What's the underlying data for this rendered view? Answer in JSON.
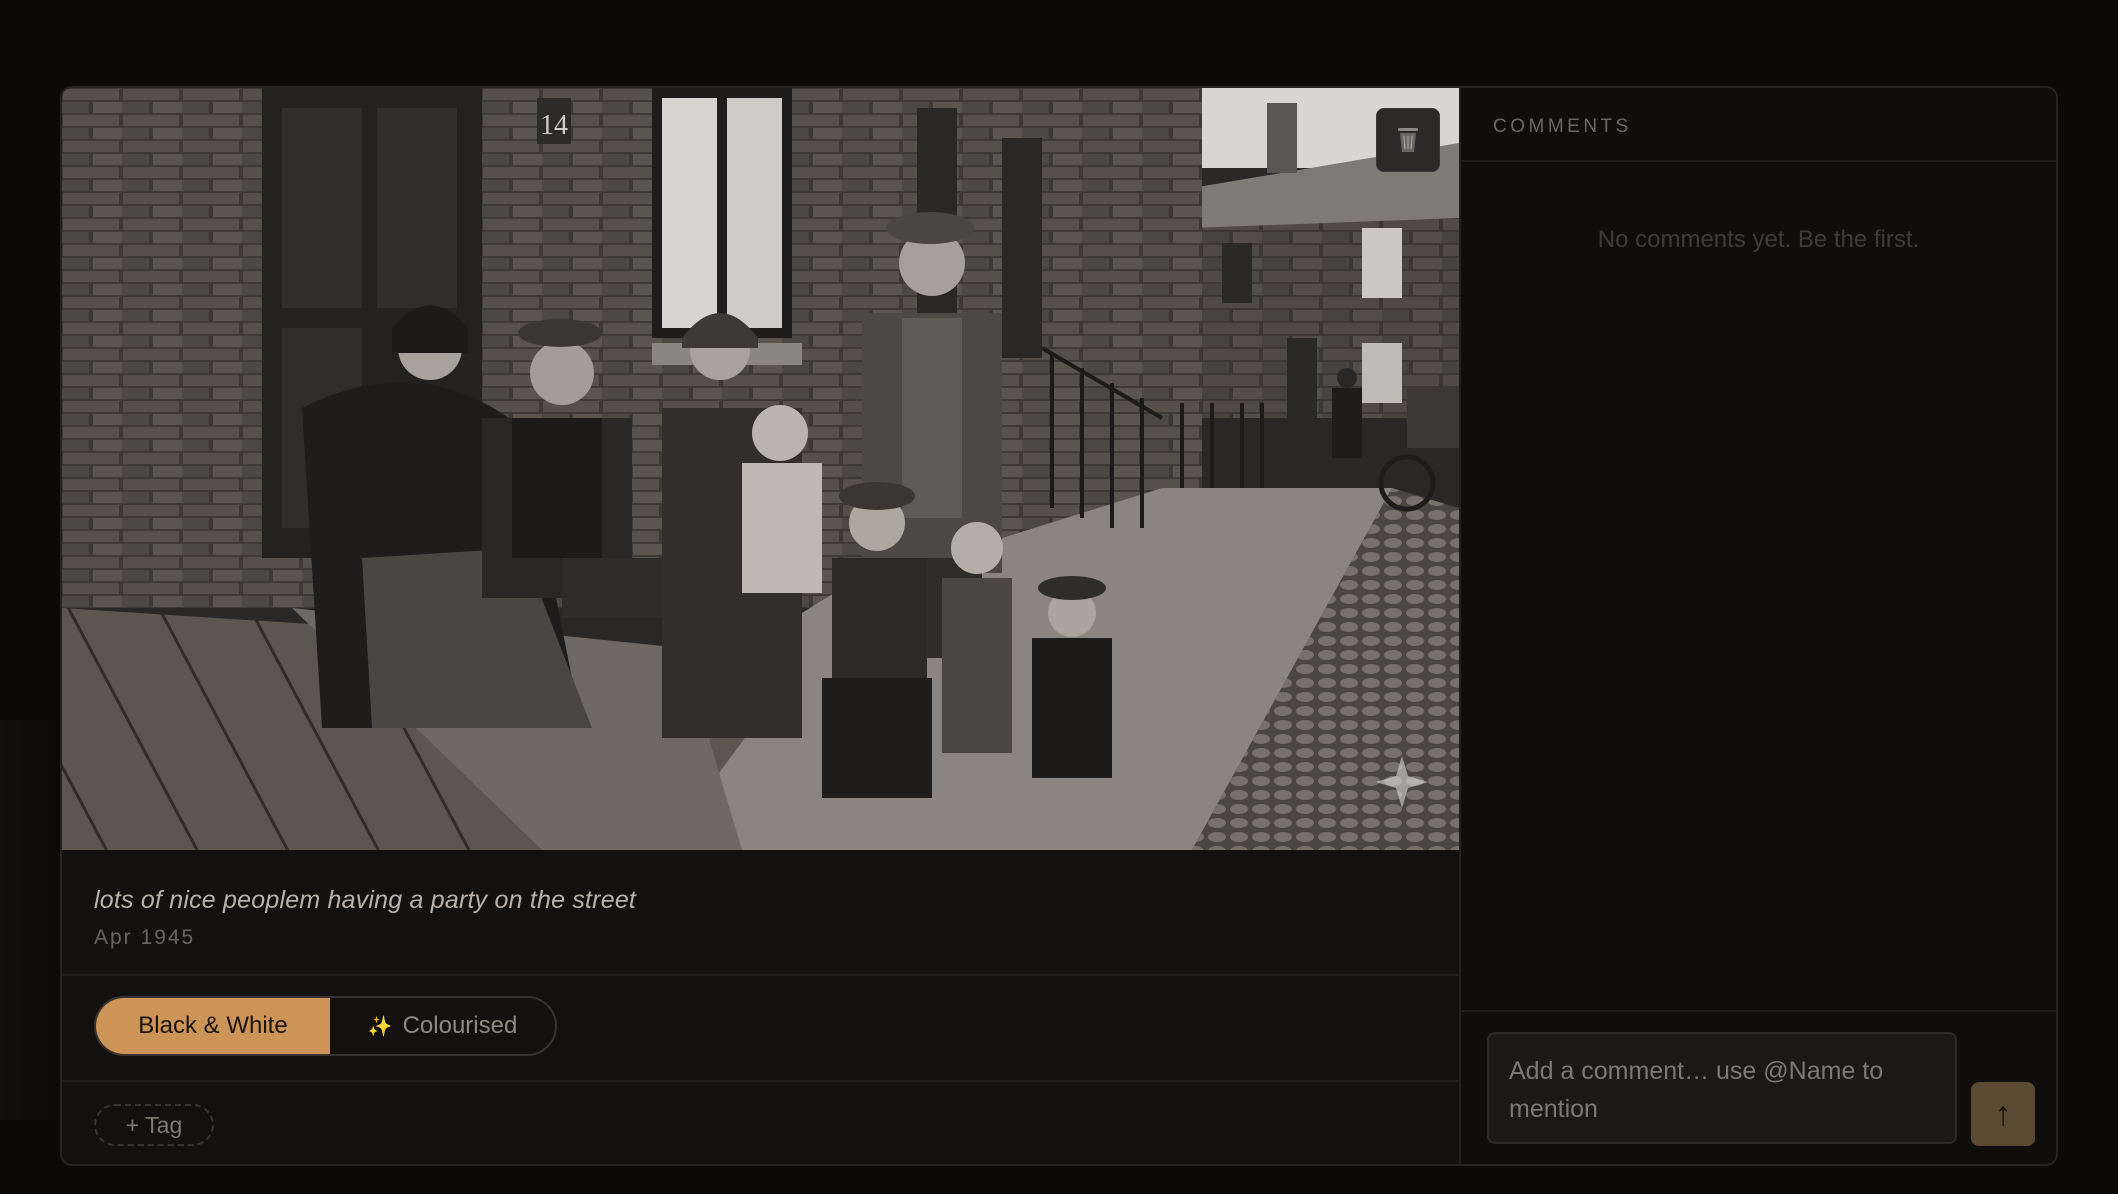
{
  "photo": {
    "alt": "",
    "door_number": "14",
    "delete_icon": "trash-icon",
    "watermark_icon": "sparkle-icon"
  },
  "caption": "lots of nice peoplem having a party on the street",
  "date": "Apr 1945",
  "toggle": {
    "options": [
      {
        "label": "Black & White",
        "selected": true
      },
      {
        "label": "Colourised",
        "icon": "sparkles-icon",
        "selected": false
      }
    ]
  },
  "tag_button": "+ Tag",
  "comments": {
    "title": "COMMENTS",
    "empty_message": "No comments yet. Be the first.",
    "input_placeholder": "Add a comment… use @Name to mention",
    "send_icon": "arrow-up-icon"
  },
  "colors": {
    "accent": "#cc9456",
    "send_button": "#5a4a32",
    "background": "#121110"
  }
}
